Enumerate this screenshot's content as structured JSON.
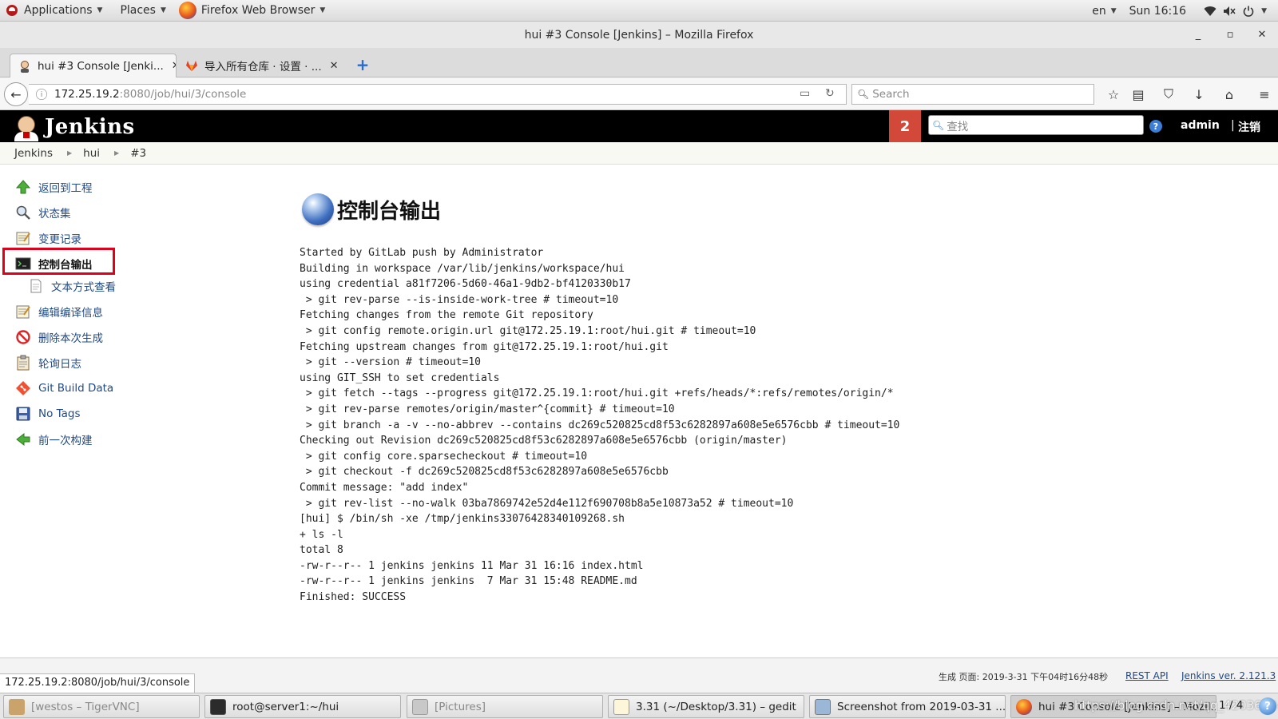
{
  "topbar": {
    "applications": "Applications",
    "places": "Places",
    "active_app": "Firefox Web Browser",
    "language": "en",
    "clock": "Sun 16:16"
  },
  "window": {
    "title": "hui #3 Console [Jenkins] – Mozilla Firefox"
  },
  "tabs": [
    {
      "label": "hui #3 Console [Jenki...",
      "active": true
    },
    {
      "label": "导入所有仓库 · 设置 · ...",
      "active": false
    }
  ],
  "navbar": {
    "url_host": "172.25.19.2",
    "url_path": ":8080/job/hui/3/console",
    "search_placeholder": "Search"
  },
  "jenkins": {
    "logo_text": "Jenkins",
    "notification_count": "2",
    "search_placeholder": "查找",
    "help": "?",
    "user": "admin",
    "separator": "|",
    "logout": "注销"
  },
  "breadcrumb": [
    "Jenkins",
    "hui",
    "#3"
  ],
  "side_tasks": [
    {
      "label": "返回到工程",
      "icon": "up-arrow-icon"
    },
    {
      "label": "状态集",
      "icon": "magnifier-icon"
    },
    {
      "label": "变更记录",
      "icon": "notepad-icon"
    },
    {
      "label": "控制台输出",
      "icon": "terminal-icon"
    },
    {
      "label": "文本方式查看",
      "icon": "document-icon"
    },
    {
      "label": "编辑编译信息",
      "icon": "notepad-icon"
    },
    {
      "label": "删除本次生成",
      "icon": "no-entry-icon"
    },
    {
      "label": "轮询日志",
      "icon": "clipboard-icon"
    },
    {
      "label": "Git Build Data",
      "icon": "git-icon"
    },
    {
      "label": "No Tags",
      "icon": "save-icon"
    },
    {
      "label": "前一次构建",
      "icon": "left-arrow-icon"
    }
  ],
  "main": {
    "title": "控制台输出",
    "console_lines": [
      "Started by GitLab push by Administrator",
      "Building in workspace /var/lib/jenkins/workspace/hui",
      "using credential a81f7206-5d60-46a1-9db2-bf4120330b17",
      " > git rev-parse --is-inside-work-tree # timeout=10",
      "Fetching changes from the remote Git repository",
      " > git config remote.origin.url git@172.25.19.1:root/hui.git # timeout=10",
      "Fetching upstream changes from git@172.25.19.1:root/hui.git",
      " > git --version # timeout=10",
      "using GIT_SSH to set credentials",
      " > git fetch --tags --progress git@172.25.19.1:root/hui.git +refs/heads/*:refs/remotes/origin/*",
      " > git rev-parse remotes/origin/master^{commit} # timeout=10",
      " > git branch -a -v --no-abbrev --contains dc269c520825cd8f53c6282897a608e5e6576cbb # timeout=10",
      "Checking out Revision dc269c520825cd8f53c6282897a608e5e6576cbb (origin/master)",
      " > git config core.sparsecheckout # timeout=10",
      " > git checkout -f dc269c520825cd8f53c6282897a608e5e6576cbb",
      "Commit message: \"add index\"",
      " > git rev-list --no-walk 03ba7869742e52d4e112f690708b8a5e10873a52 # timeout=10",
      "[hui] $ /bin/sh -xe /tmp/jenkins3307642834010926 8.sh",
      "+ ls -l",
      "total 8",
      "-rw-r--r-- 1 jenkins jenkins 11 Mar 31 16:16 index.html",
      "-rw-r--r-- 1 jenkins jenkins  7 Mar 31 15:48 README.md",
      "Finished: SUCCESS"
    ]
  },
  "footer": {
    "generated": "生成 页面: 2019-3-31 下午04时16分48秒",
    "rest_api": "REST API",
    "version": "Jenkins ver. 2.121.3",
    "status_url": "172.25.19.2:8080/job/hui/3/console"
  },
  "taskbar": {
    "items": [
      {
        "label": "[westos – TigerVNC]",
        "dim": true
      },
      {
        "label": "root@server1:~/hui",
        "dim": false
      },
      {
        "label": "[Pictures]",
        "dim": true
      },
      {
        "label": "3.31 (~/Desktop/3.31) – gedit",
        "dim": false
      },
      {
        "label": "Screenshot from 2019-03-31 ...",
        "dim": false
      },
      {
        "label": "hui #3 Console [Jenkins] – Mozil...",
        "dim": false
      }
    ],
    "workspace": "1 / 4",
    "watermark": "https://blog.csdn.net/qq_42036824"
  }
}
